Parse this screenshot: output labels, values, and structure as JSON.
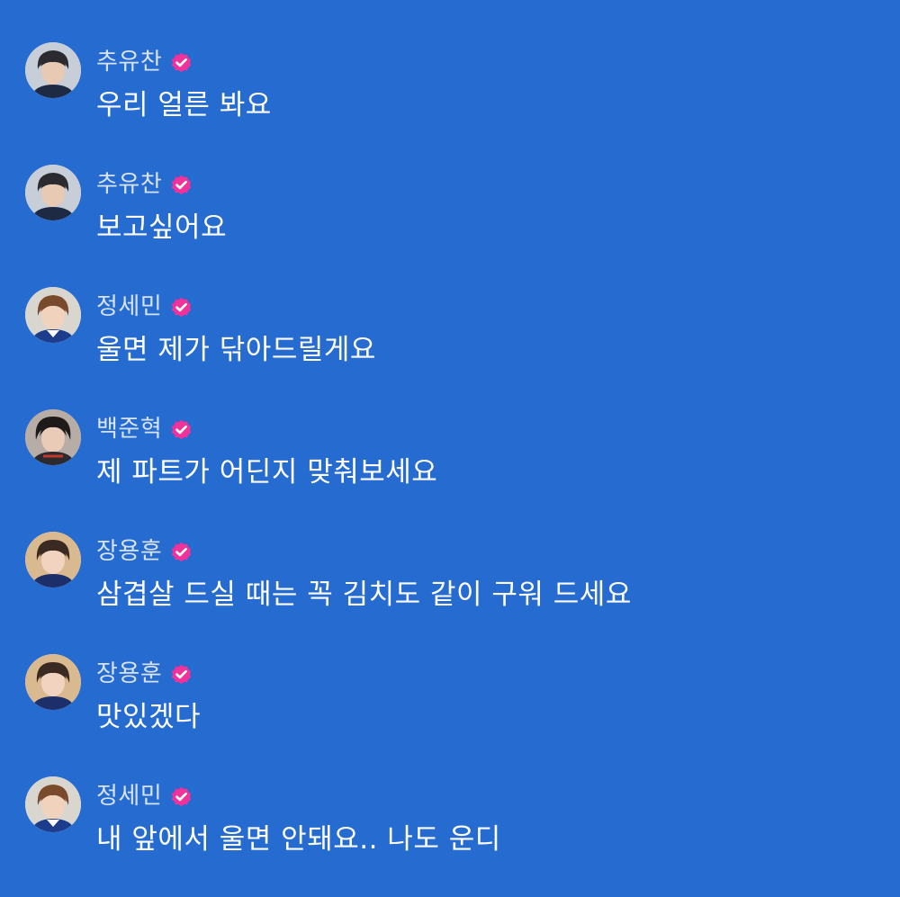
{
  "colors": {
    "background": "#256bd0",
    "name_text": "#d8e3f6",
    "message_text": "#ffffff",
    "verified_badge": "#f0329a"
  },
  "comments": [
    {
      "name": "추유찬",
      "verified": true,
      "avatar_icon": "avatar-photo",
      "message": "우리 얼른 봐요"
    },
    {
      "name": "추유찬",
      "verified": true,
      "avatar_icon": "avatar-photo",
      "message": "보고싶어요"
    },
    {
      "name": "정세민",
      "verified": true,
      "avatar_icon": "avatar-photo",
      "message": "울면 제가 닦아드릴게요"
    },
    {
      "name": "백준혁",
      "verified": true,
      "avatar_icon": "avatar-photo",
      "message": "제 파트가 어딘지 맞춰보세요"
    },
    {
      "name": "장용훈",
      "verified": true,
      "avatar_icon": "avatar-photo",
      "message": "삼겹살 드실 때는 꼭 김치도 같이 구워 드세요"
    },
    {
      "name": "장용훈",
      "verified": true,
      "avatar_icon": "avatar-photo",
      "message": "맛있겠다"
    },
    {
      "name": "정세민",
      "verified": true,
      "avatar_icon": "avatar-photo",
      "message": "내 앞에서 울면 안돼요.. 나도 운디"
    }
  ]
}
